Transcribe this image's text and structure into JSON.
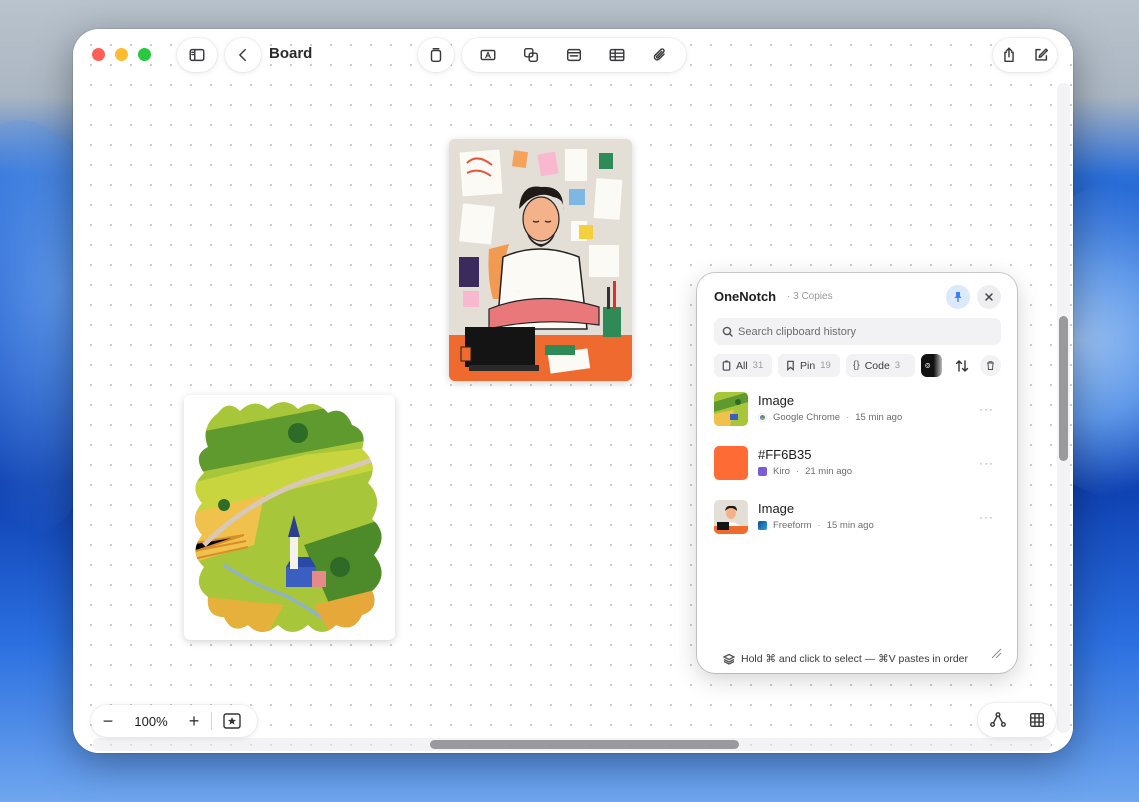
{
  "window": {
    "title": "Board"
  },
  "toolbar": {
    "left": [
      "sidebar-toggle",
      "back"
    ],
    "center": [
      "sticky-note",
      "text-box",
      "shapes",
      "media",
      "table",
      "attachment"
    ],
    "right": [
      "share",
      "compose"
    ]
  },
  "zoom": {
    "minus": "−",
    "level": "100%",
    "plus": "+"
  },
  "clipboard": {
    "app_name": "OneNotch",
    "copies": "· 3 Copies",
    "search_placeholder": "Search clipboard history",
    "filters": [
      {
        "label": "All",
        "count": "31"
      },
      {
        "label": "Pin",
        "count": "19"
      },
      {
        "label": "Code",
        "count": "3"
      }
    ],
    "items": [
      {
        "title": "Image",
        "app": "Google Chrome",
        "time": "15 min ago",
        "more": "···"
      },
      {
        "title": "#FF6B35",
        "app": "Kiro",
        "time": "21 min ago",
        "more": "···",
        "swatch": "#FF6B35"
      },
      {
        "title": "Image",
        "app": "Freeform",
        "time": "15 min ago",
        "more": "···"
      }
    ],
    "footer": "Hold ⌘ and click to select — ⌘V pastes in order"
  },
  "colors": {
    "accent": "#3b82f6",
    "swatch": "#FF6B35"
  }
}
